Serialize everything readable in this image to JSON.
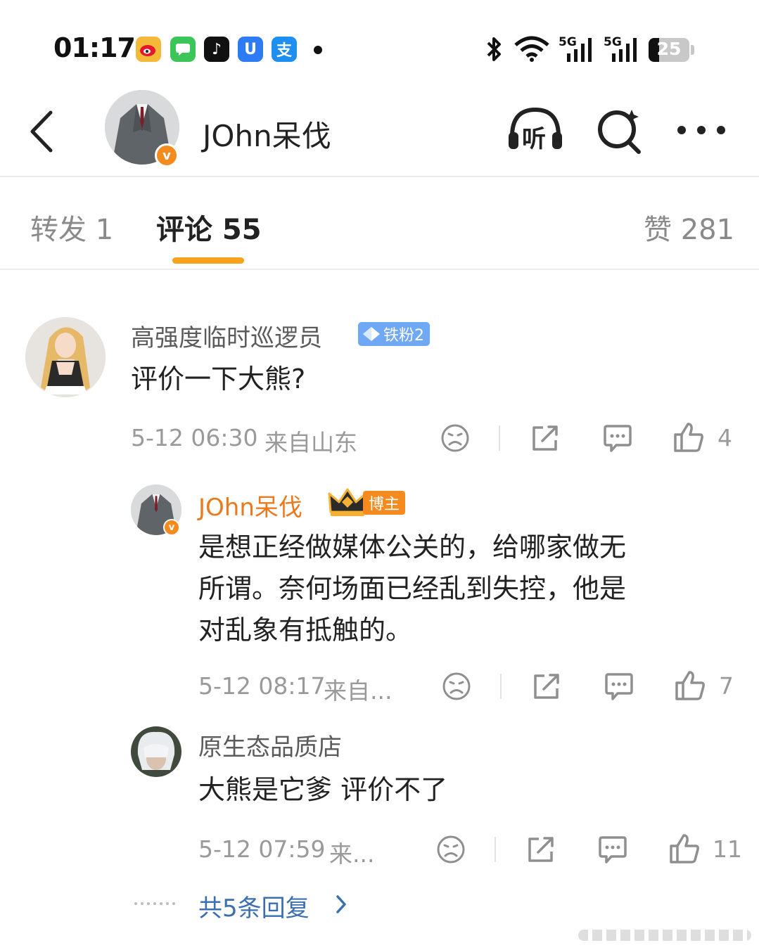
{
  "status_bar": {
    "time": "01:17",
    "app_icons": [
      {
        "name": "weibo-icon",
        "color": "#f5b93a",
        "glyph": ""
      },
      {
        "name": "messages-icon",
        "color": "#3cc65a",
        "glyph": ""
      },
      {
        "name": "tiktok-icon",
        "color": "#111111",
        "glyph": "♪"
      },
      {
        "name": "shield-app-icon",
        "color": "#2e7bf6",
        "glyph": "U"
      },
      {
        "name": "alipay-icon",
        "color": "#1f8ef1",
        "glyph": "支"
      }
    ],
    "signal_1": "5G",
    "signal_2": "5G",
    "battery": "25"
  },
  "header": {
    "username": "JOhn呆伐",
    "listen_label": "听",
    "verified_mark": "v"
  },
  "tabs": [
    {
      "label": "转发 1"
    },
    {
      "label": "评论 55"
    },
    {
      "label": "赞 281"
    }
  ],
  "comment": {
    "username": "高强度临时巡逻员",
    "fan_badge": "铁粉2",
    "text": "评价一下大熊?",
    "time": "5-12 06:30",
    "location": "来自山东",
    "likes": "4"
  },
  "replies": [
    {
      "username": "JOhn呆伐",
      "host_badge": "博主",
      "lines": [
        "是想正经做媒体公关的，给哪家做无",
        "所谓。奈何场面已经乱到失控，他是",
        "对乱象有抵触的。"
      ],
      "time": "5-12 08:17",
      "location": "来自...",
      "likes": "7"
    },
    {
      "username": "原生态品质店",
      "text": "大熊是它爹 评价不了",
      "time": "5-12 07:59",
      "location": "来...",
      "likes": "11"
    }
  ],
  "more_replies": "共5条回复"
}
